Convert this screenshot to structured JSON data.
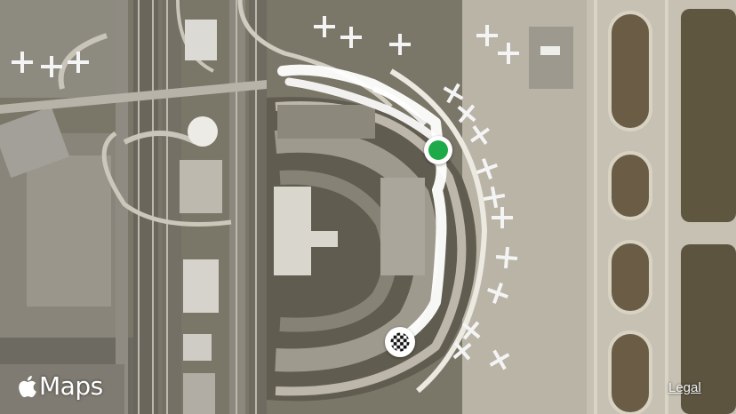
{
  "map": {
    "brand": {
      "label": "Maps"
    },
    "legal": {
      "label": "Legal"
    },
    "route": {
      "start_color": "#1faa4a",
      "finish_icon": "checkered-flag-icon",
      "line_color": "#ffffff"
    }
  }
}
